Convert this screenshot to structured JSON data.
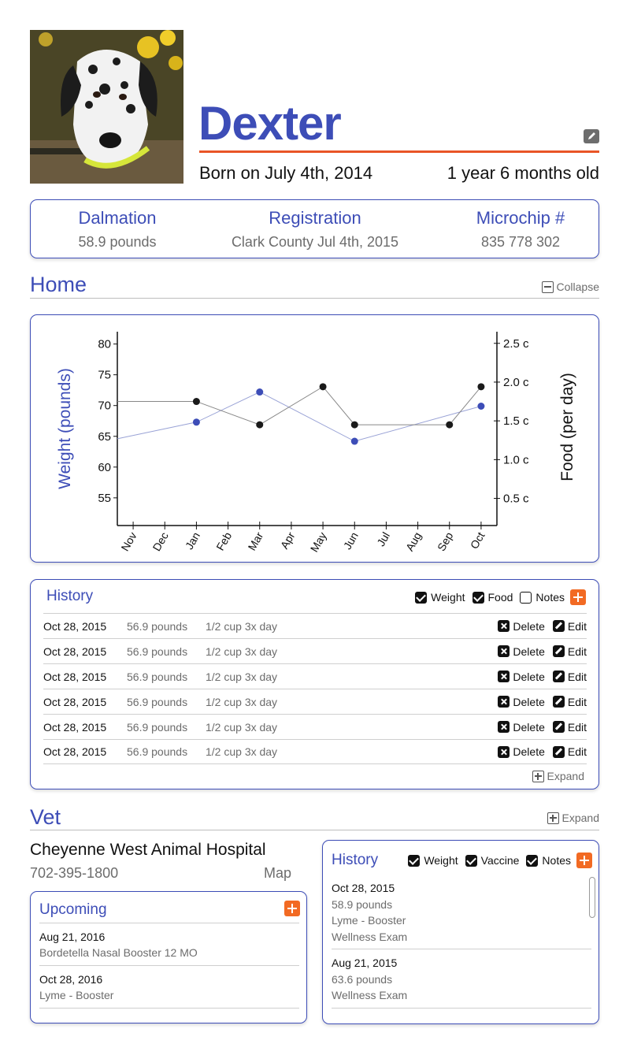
{
  "pet": {
    "name": "Dexter",
    "born": "Born on July 4th, 2014",
    "age": "1 year 6 months old"
  },
  "info": {
    "breed": "Dalmation",
    "weight": "58.9 pounds",
    "registration_label": "Registration",
    "registration_value": "Clark County Jul 4th, 2015",
    "microchip_label": "Microchip #",
    "microchip_value": "835 778 302"
  },
  "home": {
    "title": "Home",
    "collapse_label": "Collapse"
  },
  "chart_data": {
    "type": "line",
    "categories": [
      "Nov",
      "Dec",
      "Jan",
      "Feb",
      "Mar",
      "Apr",
      "May",
      "Jun",
      "Jul",
      "Aug",
      "Sep",
      "Oct"
    ],
    "ylabel": "Weight (pounds)",
    "y2label": "Food (per day)",
    "y_ticks": [
      "80",
      "75",
      "70",
      "65",
      "60",
      "55"
    ],
    "y2_ticks": [
      "2.5 c",
      "2.0 c",
      "1.5 c",
      "1.0 c",
      "0.5 c"
    ],
    "ylim": [
      50.5,
      82
    ],
    "y2lim": [
      0.15,
      2.65
    ],
    "series": [
      {
        "axis": "left",
        "color": "#3d4db7",
        "points": [
          [
            "Nov",
            64.6
          ],
          [
            "Jan",
            67.3
          ],
          [
            "Mar",
            72.2
          ],
          [
            "Jun",
            64.2
          ],
          [
            "Oct",
            69.9
          ]
        ]
      },
      {
        "axis": "right",
        "color": "#1a1a1a",
        "points": [
          [
            "Nov",
            1.75
          ],
          [
            "Jan",
            1.75
          ],
          [
            "Mar",
            1.45
          ],
          [
            "May",
            1.94
          ],
          [
            "Jun",
            1.45
          ],
          [
            "Sep",
            1.45
          ],
          [
            "Oct",
            1.94
          ]
        ]
      }
    ],
    "grid": false
  },
  "history": {
    "title": "History",
    "filters": [
      {
        "label": "Weight",
        "checked": true
      },
      {
        "label": "Food",
        "checked": true
      },
      {
        "label": "Notes",
        "checked": false
      }
    ],
    "delete_label": "Delete",
    "edit_label": "Edit",
    "expand_label": "Expand",
    "rows": [
      {
        "date": "Oct 28, 2015",
        "weight": "56.9 pounds",
        "food": "1/2 cup 3x day"
      },
      {
        "date": "Oct 28, 2015",
        "weight": "56.9 pounds",
        "food": "1/2 cup 3x day"
      },
      {
        "date": "Oct 28, 2015",
        "weight": "56.9 pounds",
        "food": "1/2 cup 3x day"
      },
      {
        "date": "Oct 28, 2015",
        "weight": "56.9 pounds",
        "food": "1/2 cup 3x day"
      },
      {
        "date": "Oct 28, 2015",
        "weight": "56.9 pounds",
        "food": "1/2 cup 3x day"
      },
      {
        "date": "Oct 28, 2015",
        "weight": "56.9 pounds",
        "food": "1/2 cup 3x day"
      }
    ]
  },
  "vet": {
    "title": "Vet",
    "expand_label": "Expand",
    "hospital": "Cheyenne West Animal Hospital",
    "phone": "702-395-1800",
    "map_label": "Map",
    "upcoming": {
      "title": "Upcoming",
      "items": [
        {
          "date": "Aug 21, 2016",
          "desc": "Bordetella Nasal Booster 12 MO"
        },
        {
          "date": "Oct 28, 2016",
          "desc": "Lyme - Booster"
        }
      ]
    },
    "history": {
      "title": "History",
      "filters": [
        {
          "label": "Weight",
          "checked": true
        },
        {
          "label": "Vaccine",
          "checked": true
        },
        {
          "label": "Notes",
          "checked": true
        }
      ],
      "entries": [
        {
          "date": "Oct 28, 2015",
          "weight": "58.9 pounds",
          "vaccine": "Lyme - Booster",
          "note": "Wellness Exam"
        },
        {
          "date": "Aug 21, 2015",
          "weight": "63.6 pounds",
          "note": "Wellness Exam"
        }
      ]
    }
  }
}
